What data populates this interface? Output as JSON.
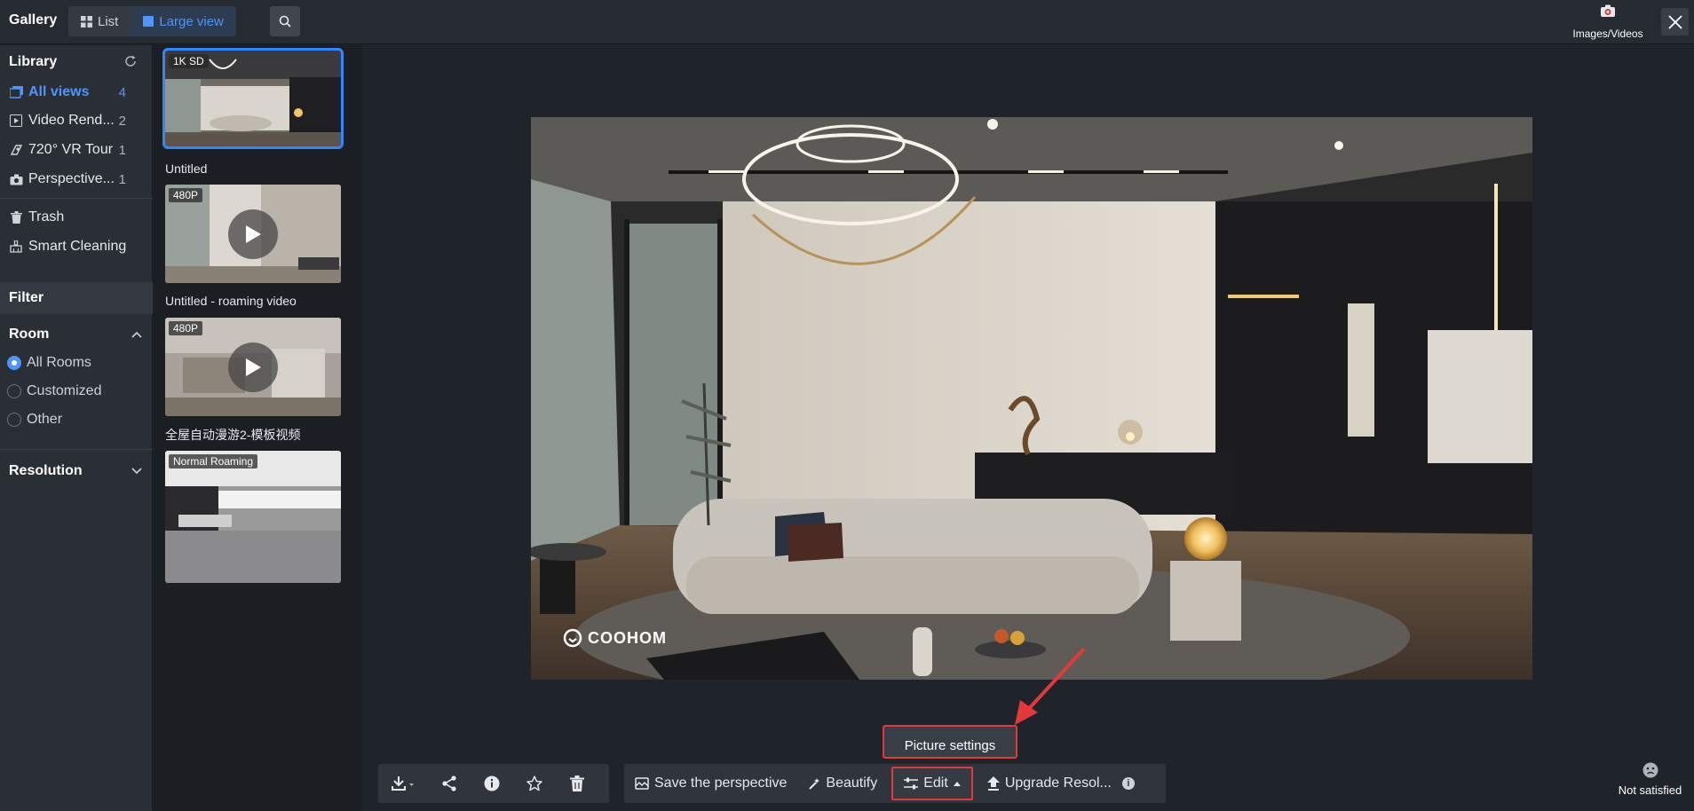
{
  "app": {
    "title": "Gallery"
  },
  "view_toggle": {
    "list_label": "List",
    "large_label": "Large view"
  },
  "header": {
    "images_videos_label": "Images/Videos"
  },
  "sidebar": {
    "library_title": "Library",
    "items": [
      {
        "label": "All views",
        "count": "4"
      },
      {
        "label": "Video Rend...",
        "count": "2"
      },
      {
        "label": "720° VR Tour",
        "count": "1"
      },
      {
        "label": "Perspective...",
        "count": "1"
      }
    ],
    "trash_label": "Trash",
    "smart_cleaning_label": "Smart Cleaning",
    "filter_title": "Filter",
    "room_title": "Room",
    "rooms": [
      "All Rooms",
      "Customized",
      "Other"
    ],
    "resolution_title": "Resolution"
  },
  "thumbnails": [
    {
      "badge": "1K SD",
      "title": "Untitled"
    },
    {
      "badge": "480P",
      "title": "Untitled - roaming video"
    },
    {
      "badge": "480P",
      "title": "全屋自动漫游2-模板视频"
    },
    {
      "badge": "Normal Roaming",
      "title": ""
    }
  ],
  "preview": {
    "watermark": "COOHOM"
  },
  "tooltip": {
    "label": "Picture settings"
  },
  "toolbar": {
    "save_perspective_label": "Save the perspective",
    "beautify_label": "Beautify",
    "edit_label": "Edit",
    "upgrade_label": "Upgrade Resol...",
    "info_glyph": "i"
  },
  "feedback": {
    "label": "Not satisfied"
  }
}
